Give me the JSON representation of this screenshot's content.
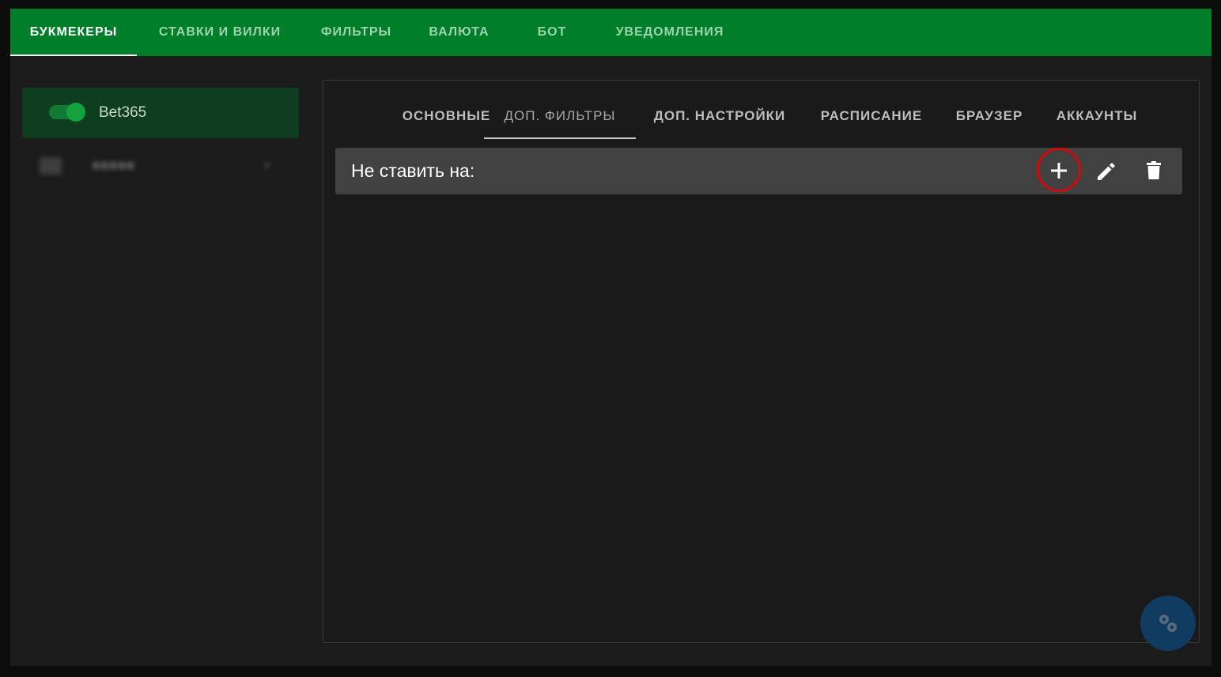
{
  "top_nav": {
    "tabs": [
      {
        "label": "БУКМЕКЕРЫ",
        "active": true
      },
      {
        "label": "СТАВКИ И ВИЛКИ",
        "active": false
      },
      {
        "label": "ФИЛЬТРЫ",
        "active": false
      },
      {
        "label": "ВАЛЮТА",
        "active": false
      },
      {
        "label": "БОТ",
        "active": false
      },
      {
        "label": "УВЕДОМЛЕНИЯ",
        "active": false
      }
    ]
  },
  "sidebar": {
    "bookmakers": [
      {
        "name": "Bet365",
        "enabled": true,
        "selected": true
      }
    ],
    "folder": {
      "icon": "folder-icon",
      "chevron": "▾"
    }
  },
  "panel": {
    "tabs": [
      {
        "label": "ОСНОВНЫЕ",
        "active": false
      },
      {
        "label": "ДОП. ФИЛЬТРЫ",
        "active": true
      },
      {
        "label": "ДОП. НАСТРОЙКИ",
        "active": false
      },
      {
        "label": "РАСПИСАНИЕ",
        "active": false
      },
      {
        "label": "БРАУЗЕР",
        "active": false
      },
      {
        "label": "АККАУНТЫ",
        "active": false
      }
    ],
    "filter_block": {
      "title": "Не ставить на:",
      "actions": [
        {
          "name": "add",
          "icon": "plus-icon"
        },
        {
          "name": "edit",
          "icon": "pencil-icon"
        },
        {
          "name": "delete",
          "icon": "trash-icon"
        }
      ]
    }
  },
  "fab": {
    "icon": "settings-gears-icon"
  },
  "colors": {
    "topbar": "#007f2a",
    "highlight_ring": "#d30a0a",
    "fab": "#0f3c60"
  }
}
